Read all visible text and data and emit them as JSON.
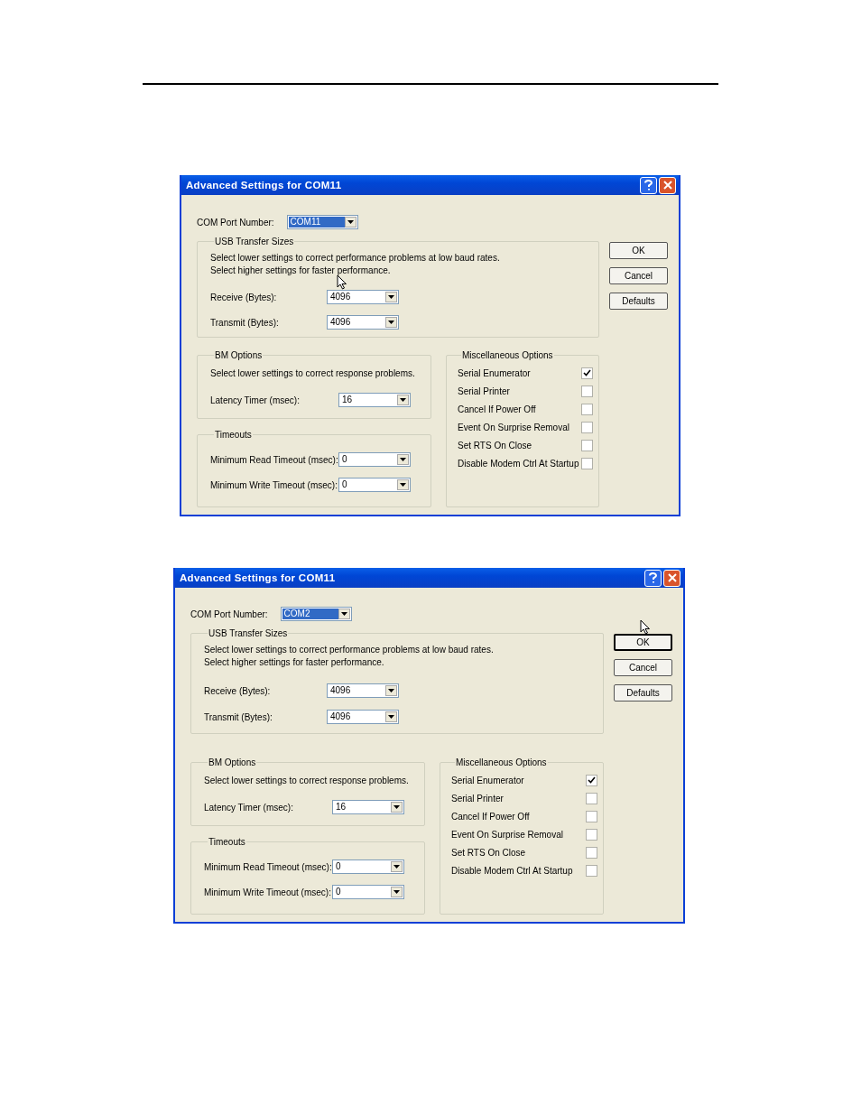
{
  "dialogs": [
    {
      "title": "Advanced Settings for COM11",
      "com_port": {
        "label": "COM Port Number:",
        "value": "COM11",
        "focused": true
      },
      "buttons": [
        {
          "label": "OK",
          "focused": false
        },
        {
          "label": "Cancel",
          "focused": false
        },
        {
          "label": "Defaults",
          "focused": false
        }
      ],
      "usb": {
        "title": "USB Transfer Sizes",
        "notes": [
          "Select lower settings to correct performance problems at low baud rates.",
          "Select higher settings for faster performance."
        ],
        "fields": [
          {
            "label": "Receive (Bytes):",
            "value": "4096"
          },
          {
            "label": "Transmit (Bytes):",
            "value": "4096"
          }
        ]
      },
      "bm": {
        "title": "BM Options",
        "note": "Select lower settings to correct response problems.",
        "fields": [
          {
            "label": "Latency Timer (msec):",
            "value": "16"
          }
        ]
      },
      "timeouts": {
        "title": "Timeouts",
        "fields": [
          {
            "label": "Minimum Read Timeout (msec):",
            "value": "0"
          },
          {
            "label": "Minimum Write Timeout (msec):",
            "value": "0"
          }
        ]
      },
      "misc": {
        "title": "Miscellaneous Options",
        "options": [
          {
            "label": "Serial Enumerator",
            "checked": true
          },
          {
            "label": "Serial Printer",
            "checked": false
          },
          {
            "label": "Cancel If Power Off",
            "checked": false
          },
          {
            "label": "Event On Surprise Removal",
            "checked": false
          },
          {
            "label": "Set RTS On Close",
            "checked": false
          },
          {
            "label": "Disable Modem Ctrl At Startup",
            "checked": false
          }
        ]
      }
    },
    {
      "title": "Advanced Settings for COM11",
      "com_port": {
        "label": "COM Port Number:",
        "value": "COM2",
        "focused": true
      },
      "buttons": [
        {
          "label": "OK",
          "focused": true
        },
        {
          "label": "Cancel",
          "focused": false
        },
        {
          "label": "Defaults",
          "focused": false
        }
      ],
      "usb": {
        "title": "USB Transfer Sizes",
        "notes": [
          "Select lower settings to correct performance problems at low baud rates.",
          "Select higher settings for faster performance."
        ],
        "fields": [
          {
            "label": "Receive (Bytes):",
            "value": "4096"
          },
          {
            "label": "Transmit (Bytes):",
            "value": "4096"
          }
        ]
      },
      "bm": {
        "title": "BM Options",
        "note": "Select lower settings to correct response problems.",
        "fields": [
          {
            "label": "Latency Timer (msec):",
            "value": "16"
          }
        ]
      },
      "timeouts": {
        "title": "Timeouts",
        "fields": [
          {
            "label": "Minimum Read Timeout (msec):",
            "value": "0"
          },
          {
            "label": "Minimum Write Timeout (msec):",
            "value": "0"
          }
        ]
      },
      "misc": {
        "title": "Miscellaneous Options",
        "options": [
          {
            "label": "Serial Enumerator",
            "checked": true
          },
          {
            "label": "Serial Printer",
            "checked": false
          },
          {
            "label": "Cancel If Power Off",
            "checked": false
          },
          {
            "label": "Event On Surprise Removal",
            "checked": false
          },
          {
            "label": "Set RTS On Close",
            "checked": false
          },
          {
            "label": "Disable Modem Ctrl At Startup",
            "checked": false
          }
        ]
      }
    }
  ]
}
